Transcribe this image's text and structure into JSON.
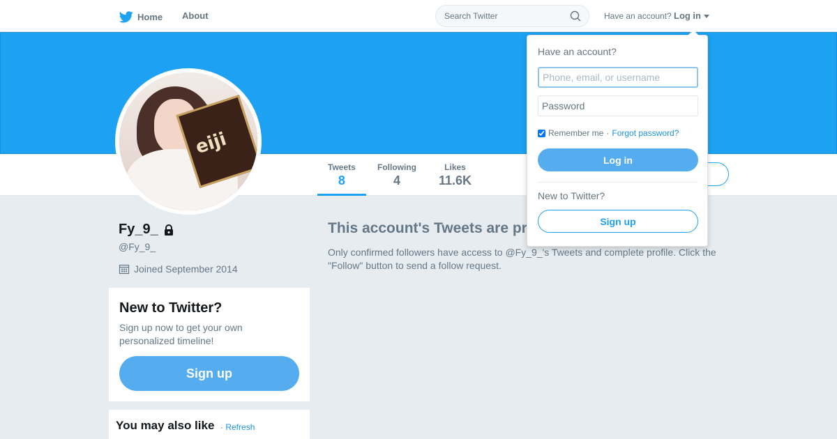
{
  "nav": {
    "home": "Home",
    "about": "About",
    "search_placeholder": "Search Twitter",
    "have_account": "Have an account?",
    "login": "Log in"
  },
  "profile": {
    "name": "Fy_9_",
    "handle": "@Fy_9_",
    "joined": "Joined September 2014",
    "stats": [
      {
        "label": "Tweets",
        "value": "8"
      },
      {
        "label": "Following",
        "value": "4"
      },
      {
        "label": "Likes",
        "value": "11.6K"
      }
    ],
    "avatar_text": "eiji"
  },
  "signup_card": {
    "title": "New to Twitter?",
    "text": "Sign up now to get your own personalized timeline!",
    "button": "Sign up"
  },
  "suggest_card": {
    "title": "You may also like",
    "sep": " · ",
    "refresh": "Refresh"
  },
  "protected": {
    "title": "This account's Tweets are protected.",
    "text": "Only confirmed followers have access to @Fy_9_'s Tweets and complete profile. Click the \"Follow\" button to send a follow request."
  },
  "login_dropdown": {
    "title": "Have an account?",
    "user_placeholder": "Phone, email, or username",
    "password_placeholder": "Password",
    "remember": "Remember me",
    "sep": " · ",
    "forgot": "Forgot password?",
    "login_button": "Log in",
    "new_to": "New to Twitter?",
    "signup_button": "Sign up"
  },
  "colors": {
    "brand": "#1da1f2",
    "button": "#55acee",
    "muted": "#657786",
    "background": "#e6ecf0"
  },
  "icons": [
    "twitter-bird-icon",
    "search-icon",
    "caret-down-icon",
    "lock-icon",
    "calendar-icon"
  ]
}
